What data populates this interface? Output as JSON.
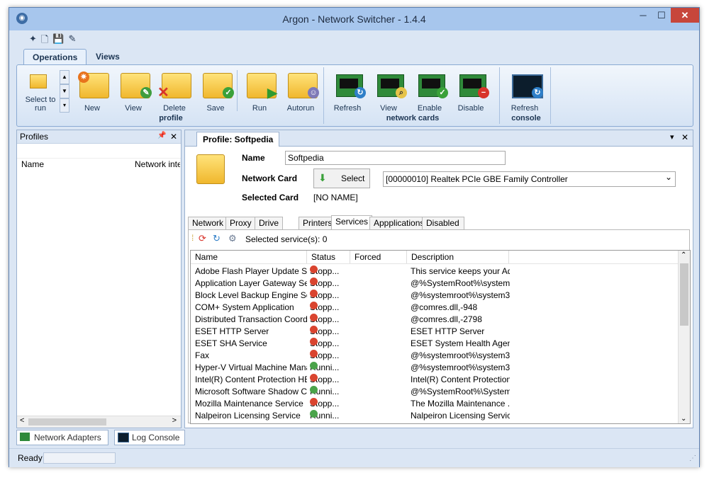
{
  "window": {
    "title": "Argon - Network Switcher - 1.4.4",
    "minimize_glyph": "─",
    "maximize_glyph": "☐",
    "close_glyph": "✕"
  },
  "quick_access": [
    "new-icon",
    "document-icon",
    "save-icon",
    "tool-icon"
  ],
  "ribbon": {
    "tabs": [
      {
        "label": "Operations",
        "active": true
      },
      {
        "label": "Views",
        "active": false
      }
    ],
    "profile_group": {
      "label": "profile",
      "select_label": "Select to run",
      "buttons": [
        {
          "label": "New",
          "icon": "new-folder-icon"
        },
        {
          "label": "View",
          "icon": "edit-folder-icon"
        },
        {
          "label": "Delete",
          "icon": "delete-folder-icon"
        },
        {
          "label": "Save",
          "icon": "save-folder-icon"
        },
        {
          "label": "Run",
          "icon": "run-folder-icon"
        },
        {
          "label": "Autorun",
          "icon": "autorun-folder-icon"
        }
      ]
    },
    "network_group": {
      "label": "network cards",
      "buttons": [
        {
          "label": "Refresh",
          "icon": "refresh-card-icon"
        },
        {
          "label": "View",
          "icon": "view-card-icon"
        },
        {
          "label": "Enable",
          "icon": "enable-card-icon"
        },
        {
          "label": "Disable",
          "icon": "disable-card-icon"
        }
      ]
    },
    "console_group": {
      "label": "console",
      "button": "Refresh"
    }
  },
  "profiles_panel": {
    "title": "Profiles",
    "pin_glyph": "📌",
    "close_glyph": "✕",
    "columns": [
      "Name",
      "Network interf"
    ],
    "scroll_left": "<",
    "scroll_right": ">"
  },
  "bottom_tabs": [
    {
      "label": "Network Adapters"
    },
    {
      "label": "Log Console"
    }
  ],
  "status": {
    "text": "Ready"
  },
  "profile": {
    "tab_label": "Profile: Softpedia",
    "name_label": "Name",
    "name_value": "Softpedia",
    "network_card_label": "Network Card",
    "select_button": "Select",
    "network_card_value": "[00000010] Realtek PCIe GBE Family Controller",
    "selected_card_label": "Selected Card",
    "selected_card_value": "[NO NAME]",
    "dropdown_glyph": "⌄",
    "close_glyph": "✕",
    "menu_glyph": "▾"
  },
  "inner_tabs": [
    {
      "label": "Network",
      "active": false
    },
    {
      "label": "Proxy",
      "active": false
    },
    {
      "label": "Drive Map",
      "active": false
    },
    {
      "label": "Printers",
      "active": false
    },
    {
      "label": "Services",
      "active": true
    },
    {
      "label": "Appplications",
      "active": false
    },
    {
      "label": "Disabled Adapters",
      "active": false
    }
  ],
  "services": {
    "selected_text": "Selected service(s): 0",
    "columns": [
      "Name",
      "Status",
      "Forced",
      "Description"
    ],
    "rows": [
      {
        "name": "Adobe Flash Player Update Ser...",
        "status": "Stopp...",
        "state": "stopped",
        "forced": "",
        "desc": "This service keeps your Ad..."
      },
      {
        "name": "Application Layer Gateway Ser...",
        "status": "Stopp...",
        "state": "stopped",
        "forced": "",
        "desc": "@%SystemRoot%\\system3..."
      },
      {
        "name": "Block Level Backup Engine Se...",
        "status": "Stopp...",
        "state": "stopped",
        "forced": "",
        "desc": "@%systemroot%\\system32..."
      },
      {
        "name": "COM+ System Application",
        "status": "Stopp...",
        "state": "stopped",
        "forced": "",
        "desc": "@comres.dll,-948"
      },
      {
        "name": "Distributed Transaction Coordin...",
        "status": "Stopp...",
        "state": "stopped",
        "forced": "",
        "desc": "@comres.dll,-2798"
      },
      {
        "name": "ESET HTTP Server",
        "status": "Stopp...",
        "state": "stopped",
        "forced": "",
        "desc": "ESET HTTP Server"
      },
      {
        "name": "ESET SHA Service",
        "status": "Stopp...",
        "state": "stopped",
        "forced": "",
        "desc": "ESET System Health Agen..."
      },
      {
        "name": "Fax",
        "status": "Stopp...",
        "state": "stopped",
        "forced": "",
        "desc": "@%systemroot%\\system32..."
      },
      {
        "name": "Hyper-V Virtual Machine Mana...",
        "status": "Runni...",
        "state": "running",
        "forced": "",
        "desc": "@%systemroot%\\system32..."
      },
      {
        "name": "Intel(R) Content Protection HE...",
        "status": "Stopp...",
        "state": "stopped",
        "forced": "",
        "desc": "Intel(R) Content Protection ..."
      },
      {
        "name": "Microsoft Software Shadow Co...",
        "status": "Runni...",
        "state": "running",
        "forced": "",
        "desc": "@%SystemRoot%\\System..."
      },
      {
        "name": "Mozilla Maintenance Service",
        "status": "Stopp...",
        "state": "stopped",
        "forced": "",
        "desc": "The Mozilla Maintenance ..."
      },
      {
        "name": "Nalpeiron Licensing Service",
        "status": "Runni...",
        "state": "running",
        "forced": "",
        "desc": "Nalpeiron Licensing Service"
      }
    ]
  },
  "colors": {
    "stopped": "#d9442f",
    "running": "#4aa34a",
    "title_bar": "#a7c6ed",
    "accent": "#1c3553"
  }
}
